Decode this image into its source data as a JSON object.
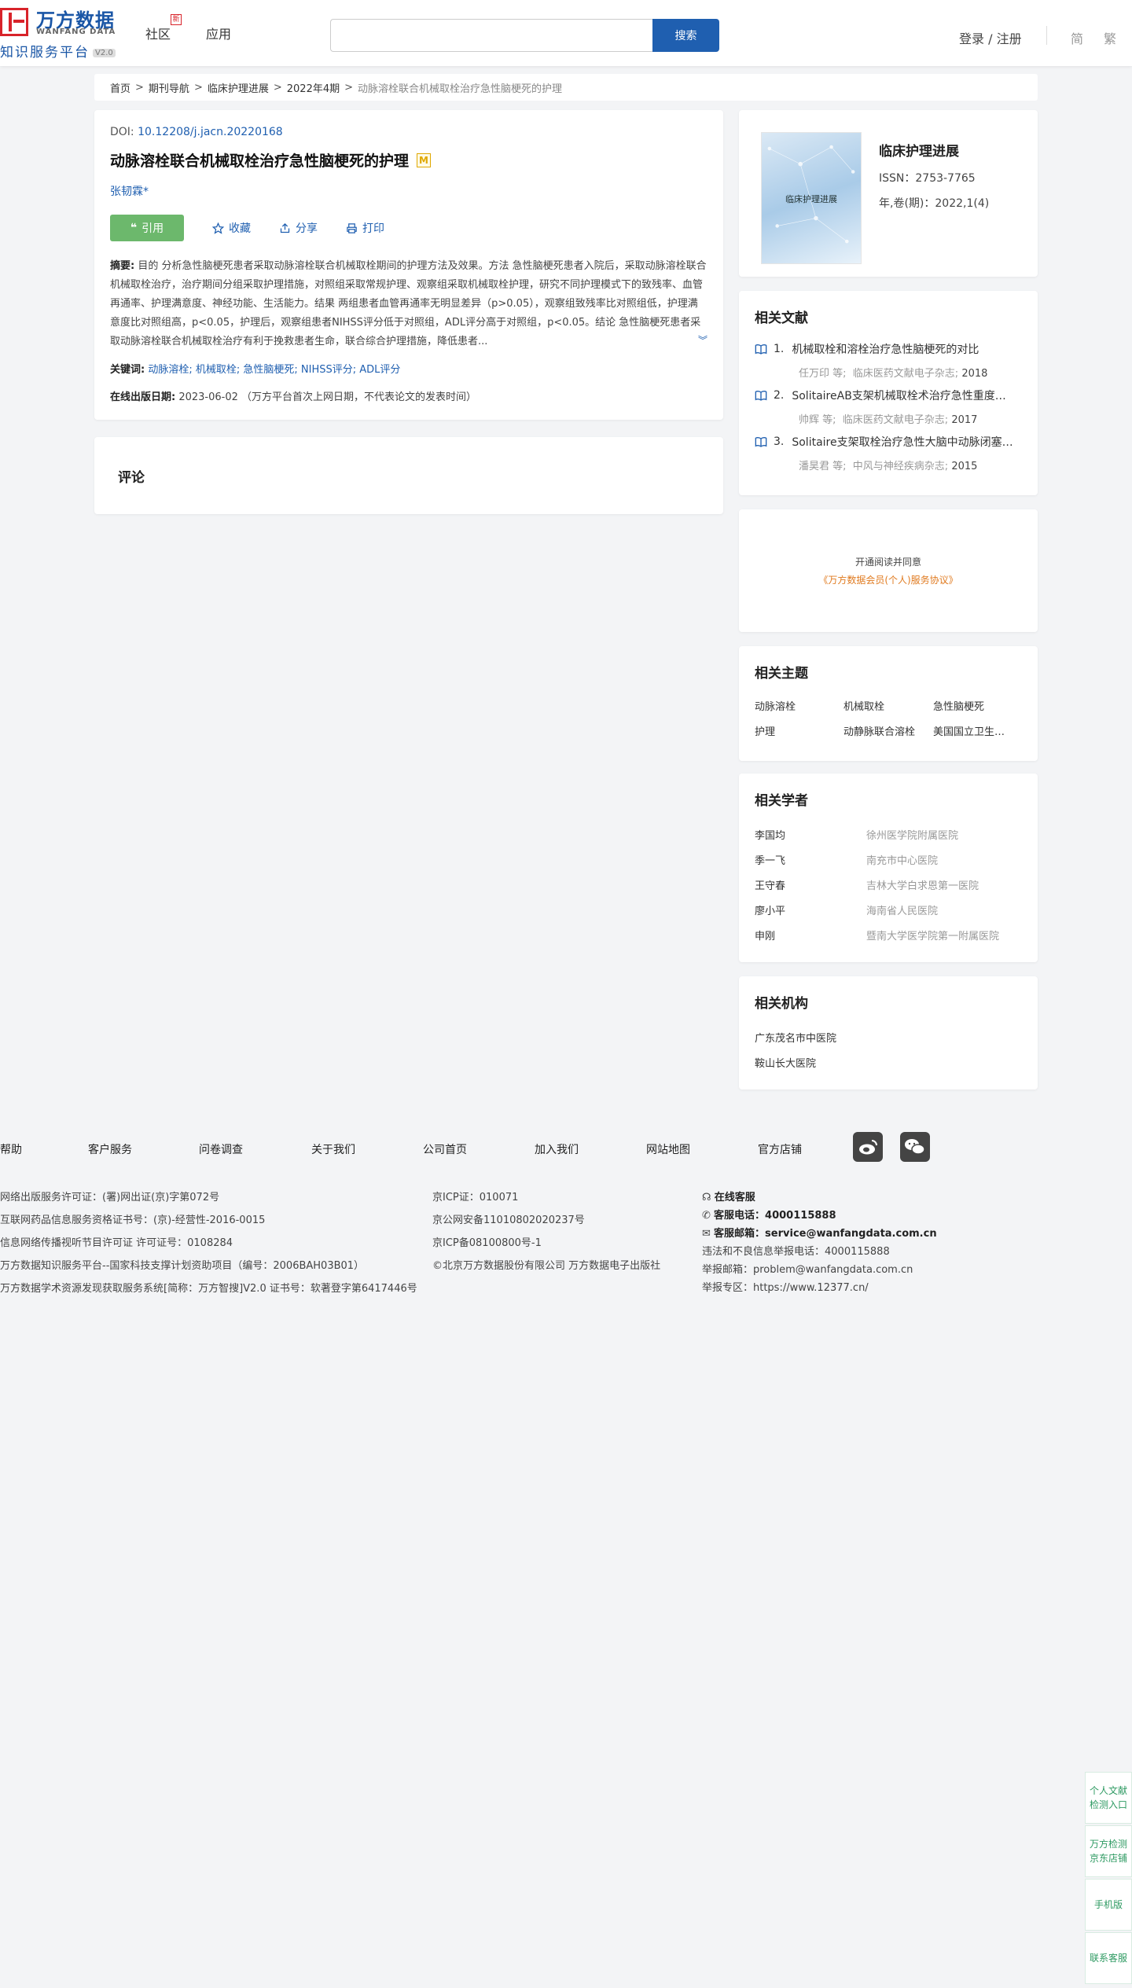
{
  "header": {
    "logo_cn": "万方数据",
    "logo_en": "WANFANG DATA",
    "logo_sub": "知识服务平台",
    "logo_ver": "V2.0",
    "nav": [
      "社区",
      "应用"
    ],
    "nav_badge": "新",
    "search_placeholder": "",
    "search_button": "搜索",
    "login": "登录 / 注册",
    "lang_simplified": "简",
    "lang_traditional": "繁"
  },
  "breadcrumb": [
    "首页",
    "期刊导航",
    "临床护理进展",
    "2022年4期",
    "动脉溶栓联合机械取栓治疗急性脑梗死的护理"
  ],
  "article": {
    "doi_label": "DOI:",
    "doi": "10.12208/j.jacn.20220168",
    "title": "动脉溶栓联合机械取栓治疗急性脑梗死的护理",
    "badge": "M",
    "author": "张韧霖*",
    "actions": {
      "cite": "引用",
      "favorite": "收藏",
      "share": "分享",
      "print": "打印"
    },
    "abstract_label": "摘要:",
    "abstract": "目的 分析急性脑梗死患者采取动脉溶栓联合机械取栓期间的护理方法及效果。方法 急性脑梗死患者入院后，采取动脉溶栓联合机械取栓治疗，治疗期间分组采取护理措施，对照组采取常规护理、观察组采取机械取栓护理，研究不同护理模式下的致残率、血管再通率、护理满意度、神经功能、生活能力。结果 两组患者血管再通率无明显差异（p>0.05），观察组致残率比对照组低，护理满意度比对照组高，p<0.05，护理后，观察组患者NIHSS评分低于对照组，ADL评分高于对照组，p<0.05。结论 急性脑梗死患者采取动脉溶栓联合机械取栓治疗有利于挽救患者生命，联合综合护理措施，降低患者...",
    "keywords_label": "关键词:",
    "keywords": "动脉溶栓; 机械取栓; 急性脑梗死; NIHSS评分; ADL评分",
    "pub_label": "在线出版日期:",
    "pub_date": "2023-06-02",
    "pub_note": "（万方平台首次上网日期，不代表论文的发表时间）"
  },
  "comment": {
    "title": "评论"
  },
  "journal": {
    "cover_title": "临床护理进展",
    "name": "临床护理进展",
    "issn": "ISSN：2753-7765",
    "volume": "年,卷(期)：2022,1(4)"
  },
  "related_docs": {
    "title": "相关文献",
    "items": [
      {
        "num": "1.",
        "title": "机械取栓和溶栓治疗急性脑梗死的对比",
        "author": "任万印 等;",
        "source": "临床医药文献电子杂志;",
        "year": "2018"
      },
      {
        "num": "2.",
        "title": "SolitaireAB支架机械取栓术治疗急性重度脑梗死的疗效观察",
        "author": "帅辉 等;",
        "source": "临床医药文献电子杂志;",
        "year": "2017"
      },
      {
        "num": "3.",
        "title": "Solitaire支架取栓治疗急性大脑中动脉闭塞的临床观察",
        "author": "潘昊君 等;",
        "source": "中风与神经疾病杂志;",
        "year": "2015"
      }
    ]
  },
  "agreement": {
    "text": "开通阅读并同意",
    "link": "《万方数据会员(个人)服务协议》"
  },
  "topics": {
    "title": "相关主题",
    "items": [
      "动脉溶栓",
      "机械取栓",
      "急性脑梗死",
      "护理",
      "动静脉联合溶栓",
      "美国国立卫生研究院卒中量表"
    ]
  },
  "scholars": {
    "title": "相关学者",
    "items": [
      {
        "name": "李国均",
        "org": "徐州医学院附属医院"
      },
      {
        "name": "季一飞",
        "org": "南充市中心医院"
      },
      {
        "name": "王守春",
        "org": "吉林大学白求恩第一医院"
      },
      {
        "name": "廖小平",
        "org": "海南省人民医院"
      },
      {
        "name": "申刚",
        "org": "暨南大学医学院第一附属医院"
      }
    ]
  },
  "orgs": {
    "title": "相关机构",
    "items": [
      "广东茂名市中医院",
      "鞍山长大医院"
    ]
  },
  "footer": {
    "nav": [
      "帮助",
      "客户服务",
      "问卷调查",
      "关于我们",
      "公司首页",
      "加入我们",
      "网站地图",
      "官方店铺"
    ],
    "col1": [
      "网络出版服务许可证：(署)网出证(京)字第072号",
      "互联网药品信息服务资格证书号：(京)-经营性-2016-0015",
      "信息网络传播视听节目许可证 许可证号：0108284",
      "万方数据知识服务平台--国家科技支撑计划资助项目（编号：2006BAH03B01）",
      "万方数据学术资源发现获取服务系统[简称：万方智搜]V2.0 证书号：软著登字第6417446号"
    ],
    "col2": [
      "京ICP证：010071",
      "京公网安备11010802020237号",
      "京ICP备08100800号-1",
      "©北京万方数据股份有限公司 万方数据电子出版社"
    ],
    "service_title": "在线客服",
    "phone_label": "客服电话：",
    "phone": "4000115888",
    "email_label": "客服邮箱：",
    "email": "service@wanfangdata.com.cn",
    "report_phone": "违法和不良信息举报电话：4000115888",
    "report_email": "举报邮箱：problem@wanfangdata.com.cn",
    "report_zone": "举报专区：https://www.12377.cn/"
  },
  "float": [
    "个人文献检测入口",
    "万方检测京东店铺",
    "手机版",
    "联系客服"
  ]
}
